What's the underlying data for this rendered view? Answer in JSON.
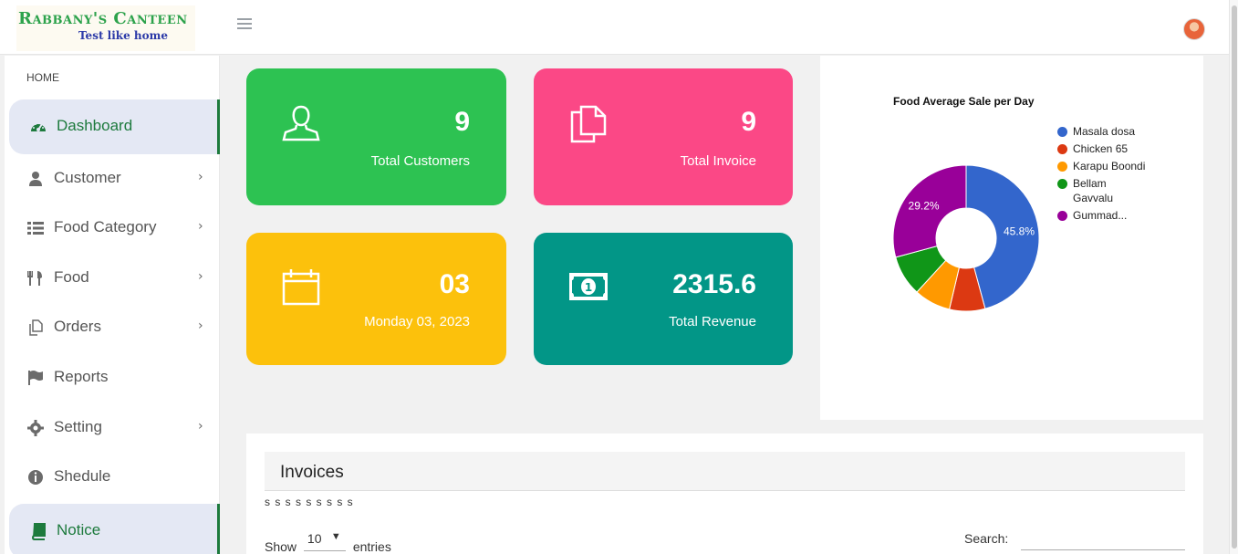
{
  "brand": {
    "title": "Rabbany's Canteen",
    "tagline": "Test like home"
  },
  "sidebar": {
    "section_label": "HOME",
    "items": [
      {
        "label": "Dashboard",
        "icon": "gauge-icon",
        "active": true,
        "has_submenu": false
      },
      {
        "label": "Customer",
        "icon": "user-icon",
        "has_submenu": true
      },
      {
        "label": "Food Category",
        "icon": "list-icon",
        "has_submenu": true
      },
      {
        "label": "Food",
        "icon": "cutlery-icon",
        "has_submenu": true
      },
      {
        "label": "Orders",
        "icon": "copy-icon",
        "has_submenu": true
      },
      {
        "label": "Reports",
        "icon": "flag-icon",
        "has_submenu": false
      },
      {
        "label": "Setting",
        "icon": "gear-icon",
        "has_submenu": true
      },
      {
        "label": "Shedule",
        "icon": "info-icon",
        "has_submenu": false
      },
      {
        "label": "Notice",
        "icon": "book-icon",
        "active": true,
        "has_submenu": false
      }
    ]
  },
  "cards": {
    "customers": {
      "value": "9",
      "label": "Total Customers",
      "icon": "user-outline-icon",
      "color": "#2dc252"
    },
    "invoice": {
      "value": "9",
      "label": "Total Invoice",
      "icon": "documents-icon",
      "color": "#fb4886"
    },
    "date": {
      "value": "03",
      "label": "Monday 03, 2023",
      "icon": "calendar-icon",
      "color": "#fcc10c"
    },
    "revenue": {
      "value": "2315.6",
      "label": "Total Revenue",
      "icon": "money-icon",
      "color": "#029687"
    }
  },
  "chart_data": {
    "type": "pie",
    "title": "Food Average Sale per Day",
    "donut": true,
    "legend_position": "right",
    "labels": [
      "Masala dosa",
      "Chicken 65",
      "Karapu Boondi",
      "Bellam Gavvalu",
      "Gummad..."
    ],
    "values": [
      45.8,
      7.9,
      8.1,
      9.0,
      29.2
    ],
    "colors": [
      "#3366cc",
      "#dc3912",
      "#ff9900",
      "#109618",
      "#990099"
    ],
    "shown_percent_labels": [
      "45.8%",
      "29.2%"
    ]
  },
  "invoices": {
    "title": "Invoices",
    "subtitle": "s s s s s s s s s",
    "show_label": "Show",
    "entries_value": "10",
    "entries_label": "entries",
    "search_label": "Search:",
    "search_value": ""
  }
}
